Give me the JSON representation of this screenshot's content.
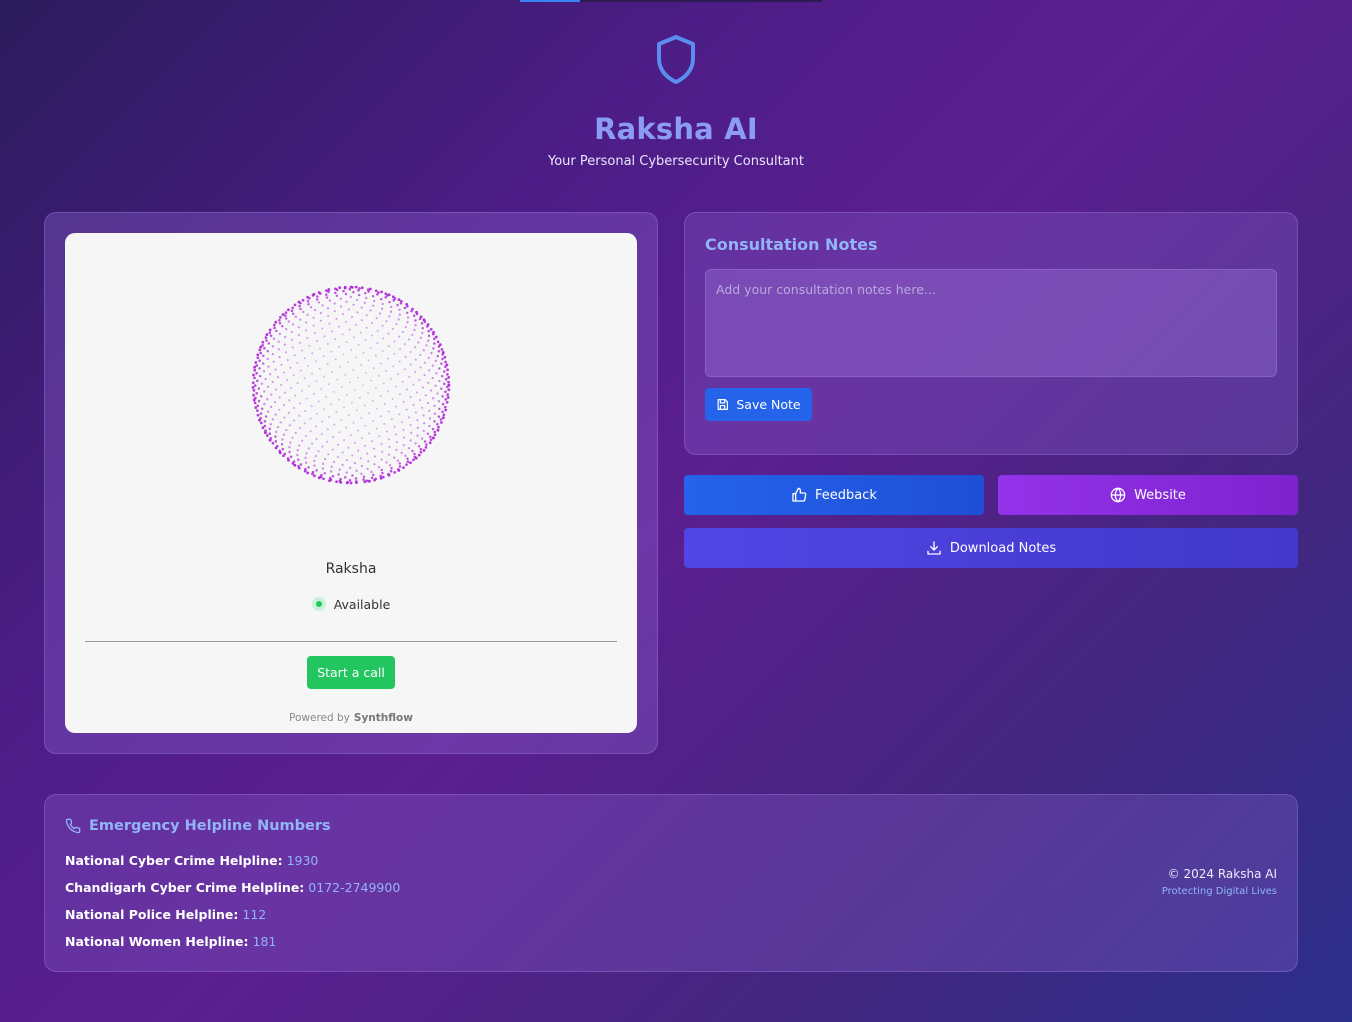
{
  "header": {
    "title": "Raksha AI",
    "subtitle": "Your Personal Cybersecurity Consultant"
  },
  "widget": {
    "agent_name": "Raksha",
    "status": "Available",
    "call_button": "Start a call",
    "powered_by": "Powered by",
    "brand": "Synthflow"
  },
  "notes": {
    "title": "Consultation Notes",
    "placeholder": "Add your consultation notes here...",
    "save_label": "Save Note"
  },
  "actions": {
    "feedback": "Feedback",
    "website": "Website",
    "download": "Download Notes"
  },
  "helplines": {
    "title": "Emergency Helpline Numbers",
    "items": [
      {
        "label": "National Cyber Crime Helpline:",
        "number": "1930"
      },
      {
        "label": "Chandigarh Cyber Crime Helpline:",
        "number": "0172-2749900"
      },
      {
        "label": "National Police Helpline:",
        "number": "112"
      },
      {
        "label": "National Women Helpline:",
        "number": "181"
      }
    ]
  },
  "footer": {
    "copyright": "© 2024 Raksha AI",
    "tagline": "Protecting Digital Lives"
  },
  "colors": {
    "accent_blue": "#2563eb",
    "accent_purple": "#9333ea",
    "accent_indigo": "#4f46e5",
    "call_green": "#22c55e",
    "title_color": "#8b9cf7"
  },
  "icons": [
    "shield-icon",
    "save-icon",
    "thumbs-up-icon",
    "globe-icon",
    "download-icon",
    "phone-icon"
  ]
}
